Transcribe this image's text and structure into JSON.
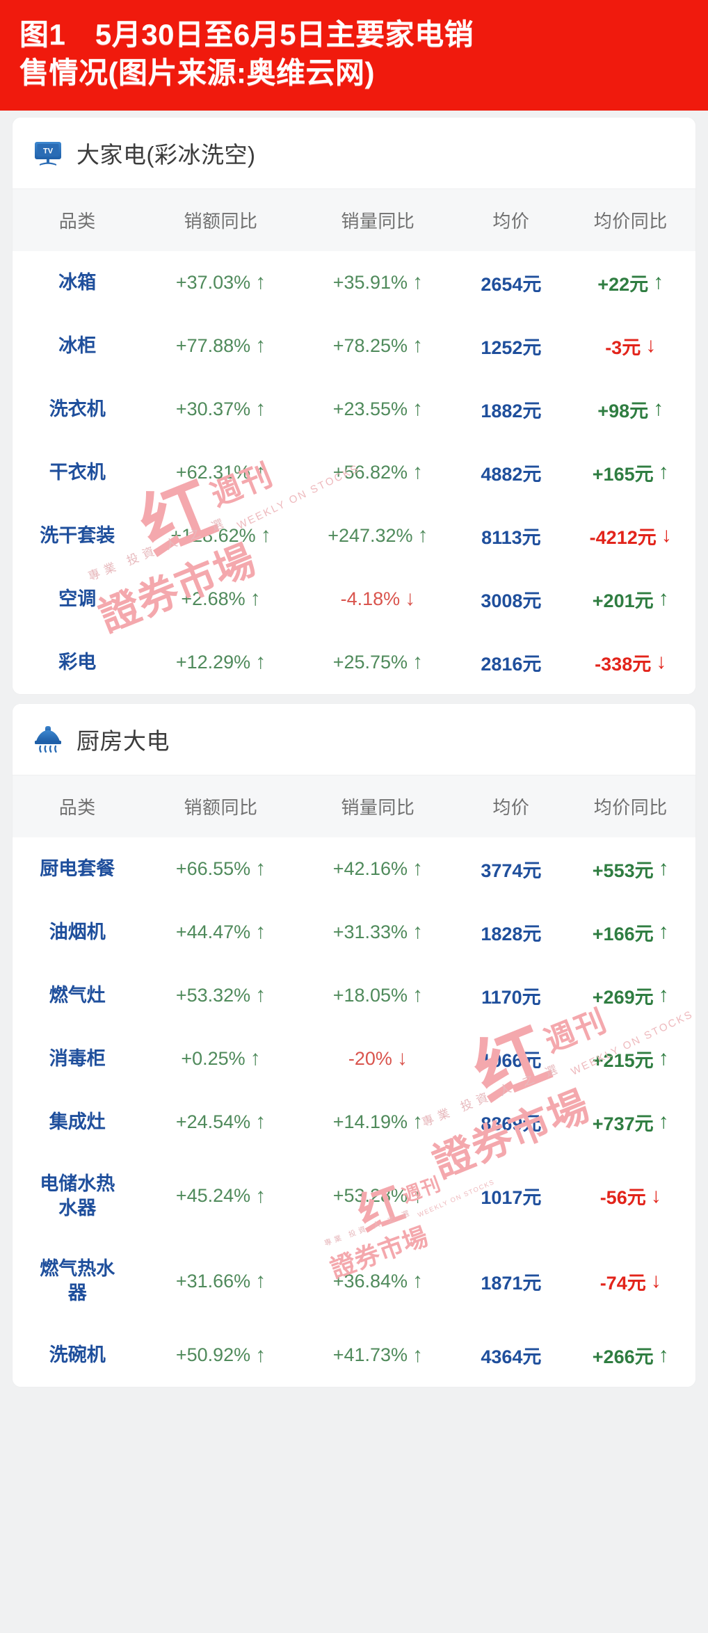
{
  "banner": {
    "title": "图1　5月30日至6月5日主要家电销\n售情况(图片来源:奥维云网)"
  },
  "watermark": {
    "big": "红",
    "zhoukan": "週刊",
    "main": "證券市場",
    "sub": "專業 投資 人 之 選",
    "en": "WEEKLY ON STOCKS"
  },
  "columns": {
    "category": "品类",
    "sales_yoy": "销额同比",
    "volume_yoy": "销量同比",
    "avg_price": "均价",
    "avg_price_yoy": "均价同比"
  },
  "sections": [
    {
      "icon": "tv-icon",
      "title": "大家电(彩冰洗空)",
      "rows": [
        {
          "category": "冰箱",
          "sales_yoy": "+37.03%",
          "sales_dir": "up",
          "volume_yoy": "+35.91%",
          "volume_dir": "up",
          "avg_price": "2654元",
          "avg_price_yoy": "+22元",
          "price_dir": "up"
        },
        {
          "category": "冰柜",
          "sales_yoy": "+77.88%",
          "sales_dir": "up",
          "volume_yoy": "+78.25%",
          "volume_dir": "up",
          "avg_price": "1252元",
          "avg_price_yoy": "-3元",
          "price_dir": "down"
        },
        {
          "category": "洗衣机",
          "sales_yoy": "+30.37%",
          "sales_dir": "up",
          "volume_yoy": "+23.55%",
          "volume_dir": "up",
          "avg_price": "1882元",
          "avg_price_yoy": "+98元",
          "price_dir": "up"
        },
        {
          "category": "干衣机",
          "sales_yoy": "+62.31%",
          "sales_dir": "up",
          "volume_yoy": "+56.82%",
          "volume_dir": "up",
          "avg_price": "4882元",
          "avg_price_yoy": "+165元",
          "price_dir": "up"
        },
        {
          "category": "洗干套装",
          "sales_yoy": "+128.62%",
          "sales_dir": "up",
          "volume_yoy": "+247.32%",
          "volume_dir": "up",
          "avg_price": "8113元",
          "avg_price_yoy": "-4212元",
          "price_dir": "down"
        },
        {
          "category": "空调",
          "sales_yoy": "+2.68%",
          "sales_dir": "up",
          "volume_yoy": "-4.18%",
          "volume_dir": "down",
          "avg_price": "3008元",
          "avg_price_yoy": "+201元",
          "price_dir": "up"
        },
        {
          "category": "彩电",
          "sales_yoy": "+12.29%",
          "sales_dir": "up",
          "volume_yoy": "+25.75%",
          "volume_dir": "up",
          "avg_price": "2816元",
          "avg_price_yoy": "-338元",
          "price_dir": "down"
        }
      ]
    },
    {
      "icon": "range-hood-icon",
      "title": "厨房大电",
      "rows": [
        {
          "category": "厨电套餐",
          "sales_yoy": "+66.55%",
          "sales_dir": "up",
          "volume_yoy": "+42.16%",
          "volume_dir": "up",
          "avg_price": "3774元",
          "avg_price_yoy": "+553元",
          "price_dir": "up"
        },
        {
          "category": "油烟机",
          "sales_yoy": "+44.47%",
          "sales_dir": "up",
          "volume_yoy": "+31.33%",
          "volume_dir": "up",
          "avg_price": "1828元",
          "avg_price_yoy": "+166元",
          "price_dir": "up"
        },
        {
          "category": "燃气灶",
          "sales_yoy": "+53.32%",
          "sales_dir": "up",
          "volume_yoy": "+18.05%",
          "volume_dir": "up",
          "avg_price": "1170元",
          "avg_price_yoy": "+269元",
          "price_dir": "up"
        },
        {
          "category": "消毒柜",
          "sales_yoy": "+0.25%",
          "sales_dir": "up",
          "volume_yoy": "-20%",
          "volume_dir": "down",
          "avg_price": "1066元",
          "avg_price_yoy": "+215元",
          "price_dir": "up"
        },
        {
          "category": "集成灶",
          "sales_yoy": "+24.54%",
          "sales_dir": "up",
          "volume_yoy": "+14.19%",
          "volume_dir": "up",
          "avg_price": "8869元",
          "avg_price_yoy": "+737元",
          "price_dir": "up"
        },
        {
          "category": "电储水热\n水器",
          "sales_yoy": "+45.24%",
          "sales_dir": "up",
          "volume_yoy": "+53.28%",
          "volume_dir": "up",
          "avg_price": "1017元",
          "avg_price_yoy": "-56元",
          "price_dir": "down"
        },
        {
          "category": "燃气热水\n器",
          "sales_yoy": "+31.66%",
          "sales_dir": "up",
          "volume_yoy": "+36.84%",
          "volume_dir": "up",
          "avg_price": "1871元",
          "avg_price_yoy": "-74元",
          "price_dir": "down"
        },
        {
          "category": "洗碗机",
          "sales_yoy": "+50.92%",
          "sales_dir": "up",
          "volume_yoy": "+41.73%",
          "volume_dir": "up",
          "avg_price": "4364元",
          "avg_price_yoy": "+266元",
          "price_dir": "up"
        }
      ]
    }
  ],
  "colors": {
    "banner_bg": "#f01a0d",
    "category_blue": "#1f4f9c",
    "up_green": "#2f7d41",
    "pct_green": "#4f8a5b",
    "down_red": "#e2241b",
    "watermark_pink": "#f4a8ad"
  },
  "arrow_glyphs": {
    "up": "↑",
    "down": "↓"
  }
}
